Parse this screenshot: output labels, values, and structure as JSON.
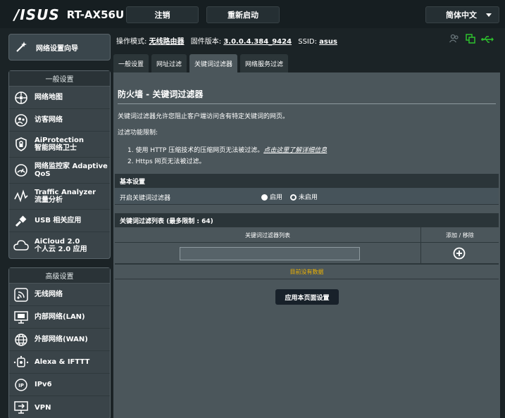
{
  "header": {
    "brand": "/ISUS",
    "model": "RT-AX56U",
    "logout_label": "注销",
    "reboot_label": "重新启动",
    "language": "简体中文"
  },
  "status": {
    "mode_label": "操作模式:",
    "mode_value": "无线路由器",
    "firmware_label": "固件版本:",
    "firmware_value": "3.0.0.4.384_9424",
    "ssid_label": "SSID:",
    "ssid_value": "asus"
  },
  "sidebar": {
    "qis_label": "网络设置向导",
    "general_title": "一般设置",
    "general_items": [
      {
        "label": "网络地图",
        "icon": "network-map-icon"
      },
      {
        "label": "访客网络",
        "icon": "guest-network-icon"
      },
      {
        "label": "AiProtection",
        "label2": "智能网络卫士",
        "icon": "aiprotection-icon"
      },
      {
        "label": "网络监控家 Adaptive",
        "label2": "QoS",
        "icon": "adaptive-qos-icon"
      },
      {
        "label": "Traffic Analyzer",
        "label2": "流量分析",
        "icon": "traffic-analyzer-icon"
      },
      {
        "label": "USB 相关应用",
        "icon": "usb-icon"
      },
      {
        "label": "AiCloud 2.0",
        "label2": "个人云 2.0 应用",
        "icon": "aicloud-icon"
      }
    ],
    "advanced_title": "高级设置",
    "advanced_items": [
      {
        "label": "无线网络",
        "icon": "wireless-icon"
      },
      {
        "label": "内部网络(LAN)",
        "icon": "lan-icon"
      },
      {
        "label": "外部网络(WAN)",
        "icon": "wan-icon"
      },
      {
        "label": "Alexa & IFTTT",
        "icon": "alexa-icon"
      },
      {
        "label": "IPv6",
        "icon": "ipv6-icon"
      },
      {
        "label": "VPN",
        "icon": "vpn-icon"
      }
    ]
  },
  "tabs": [
    "一般设置",
    "网址过滤",
    "关键词过滤器",
    "网络服务过滤"
  ],
  "main": {
    "title": "防火墙 - 关键词过滤器",
    "description": "关键词过滤器允许您阻止客户端访问含有特定关键词的网页。",
    "limits_title": "过滤功能限制:",
    "note1": "1.  使用 HTTP 压缩技术的压缩网页无法被过滤。",
    "note1_link": "点击这里了解详细信息",
    "note2": "2.  Https 网页无法被过滤。",
    "basic_header": "基本设置",
    "enable_label": "开启关键词过滤器",
    "radio_on": "启用",
    "radio_off": "未启用",
    "list_header": "关键词过滤列表 (最多限制 :  64)",
    "col_keyword": "关键词过滤器列表",
    "col_action": "添加 / 移除",
    "keyword_value": "",
    "empty_text": "目前没有数据",
    "apply_label": "应用本页面设置"
  },
  "colors": {
    "empty_text": "#f0b400",
    "usb_icon": "#20c040"
  }
}
